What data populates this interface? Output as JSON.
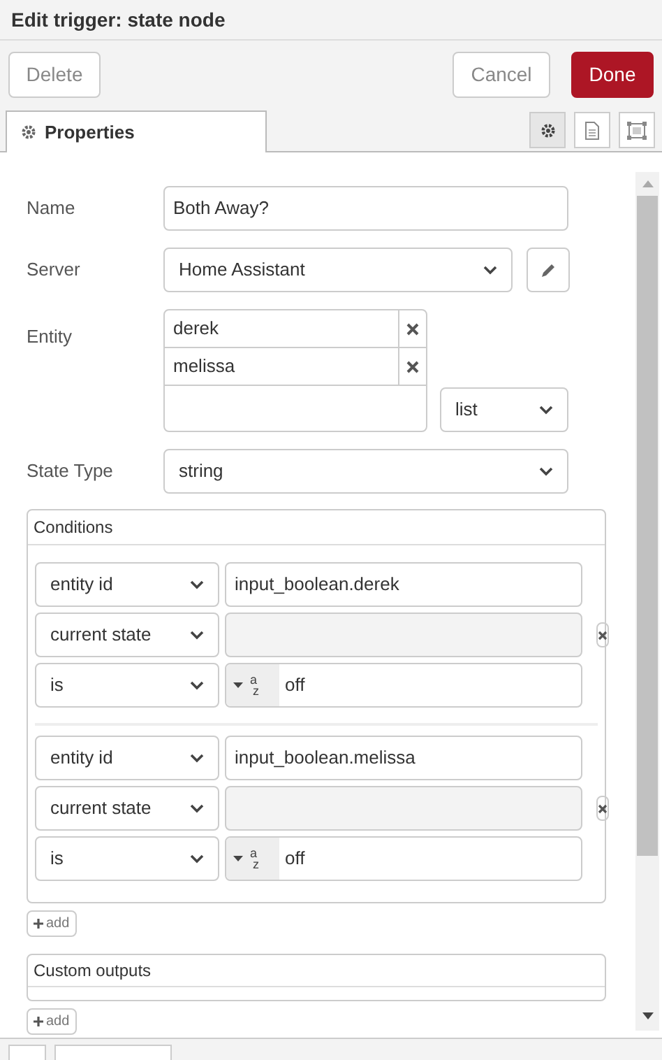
{
  "window": {
    "title": "Edit trigger: state node"
  },
  "buttons": [
    {
      "label": "Delete",
      "kind": "plain"
    },
    {
      "label": "Cancel",
      "kind": "plain"
    },
    {
      "label": "Done",
      "kind": "primary"
    }
  ],
  "tabs": [
    {
      "label": "Properties",
      "selected": true
    }
  ],
  "form": {
    "name": {
      "label": "Name",
      "value": "Both Away?"
    },
    "server": {
      "label": "Server",
      "value": "Home Assistant"
    },
    "entity": {
      "label": "Entity",
      "items": [
        "derek",
        "melissa"
      ],
      "mode": "list"
    },
    "state_type": {
      "label": "State Type",
      "value": "string"
    }
  },
  "conditions": {
    "title": "Conditions",
    "groups": [
      {
        "rows": [
          {
            "kind": "input",
            "select": "entity id",
            "value": "input_boolean.derek"
          },
          {
            "kind": "disabled",
            "select": "current state"
          },
          {
            "kind": "typed",
            "select": "is",
            "type_top": "a",
            "type_bottom": "z",
            "value": "off"
          }
        ]
      },
      {
        "rows": [
          {
            "kind": "input",
            "select": "entity id",
            "value": "input_boolean.melissa"
          },
          {
            "kind": "disabled",
            "select": "current state"
          },
          {
            "kind": "typed",
            "select": "is",
            "type_top": "a",
            "type_bottom": "z",
            "value": "off"
          }
        ]
      }
    ],
    "add_label": "add"
  },
  "custom_outputs": {
    "title": "Custom outputs",
    "add_label": "add"
  }
}
